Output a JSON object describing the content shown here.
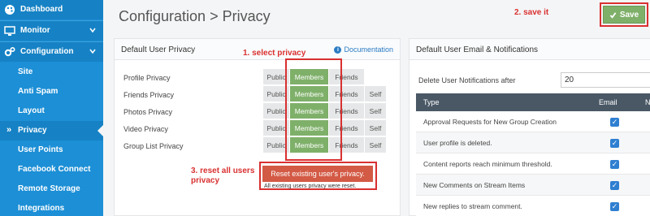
{
  "sidebar": {
    "items": [
      {
        "label": "Dashboard",
        "icon": "palette-icon"
      },
      {
        "label": "Monitor",
        "icon": "monitor-icon"
      },
      {
        "label": "Configuration",
        "icon": "gears-icon"
      },
      {
        "label": "Site"
      },
      {
        "label": "Anti Spam"
      },
      {
        "label": "Layout"
      },
      {
        "label": "Privacy",
        "marker": "»"
      },
      {
        "label": "User Points"
      },
      {
        "label": "Facebook Connect"
      },
      {
        "label": "Remote Storage"
      },
      {
        "label": "Integrations"
      }
    ]
  },
  "header": {
    "title": "Configuration > Privacy",
    "save_label": "Save",
    "annotation_save": "2. save it"
  },
  "privacy_panel": {
    "title": "Default User Privacy",
    "documentation_label": "Documentation",
    "annotation_select": "1. select privacy",
    "annotation_reset_line1": "3. reset all users",
    "annotation_reset_line2": "privacy",
    "rows": [
      {
        "label": "Profile Privacy",
        "options": [
          "Public",
          "Members",
          "Friends"
        ],
        "selected": "Members"
      },
      {
        "label": "Friends Privacy",
        "options": [
          "Public",
          "Members",
          "Friends",
          "Self"
        ],
        "selected": "Members"
      },
      {
        "label": "Photos Privacy",
        "options": [
          "Public",
          "Members",
          "Friends",
          "Self"
        ],
        "selected": "Members"
      },
      {
        "label": "Video Privacy",
        "options": [
          "Public",
          "Members",
          "Friends",
          "Self"
        ],
        "selected": "Members"
      },
      {
        "label": "Group List Privacy",
        "options": [
          "Public",
          "Members",
          "Friends",
          "Self"
        ],
        "selected": "Members"
      }
    ],
    "reset_button_label": "Reset existing user's privacy.",
    "reset_message": "All existing users privacy were reset."
  },
  "notifications_panel": {
    "title": "Default User Email & Notifications",
    "delete_after_label": "Delete User Notifications after",
    "delete_after_value": "20",
    "table": {
      "columns": [
        "Type",
        "Email",
        "N"
      ],
      "rows": [
        {
          "type": "Approval Requests for New Group Creation",
          "email": true
        },
        {
          "type": "User profile is deleted.",
          "email": true
        },
        {
          "type": "Content reports reach minimum threshold.",
          "email": true
        },
        {
          "type": "New Comments on Stream Items",
          "email": true
        },
        {
          "type": "New replies to stream comment.",
          "email": true
        }
      ]
    }
  },
  "colors": {
    "sidebar": "#1c8fd6",
    "selected_option": "#7fb06a",
    "annotation": "#d93030",
    "reset_button": "#d35a45",
    "table_header": "#4a5866",
    "checkbox": "#2f7fd1"
  }
}
